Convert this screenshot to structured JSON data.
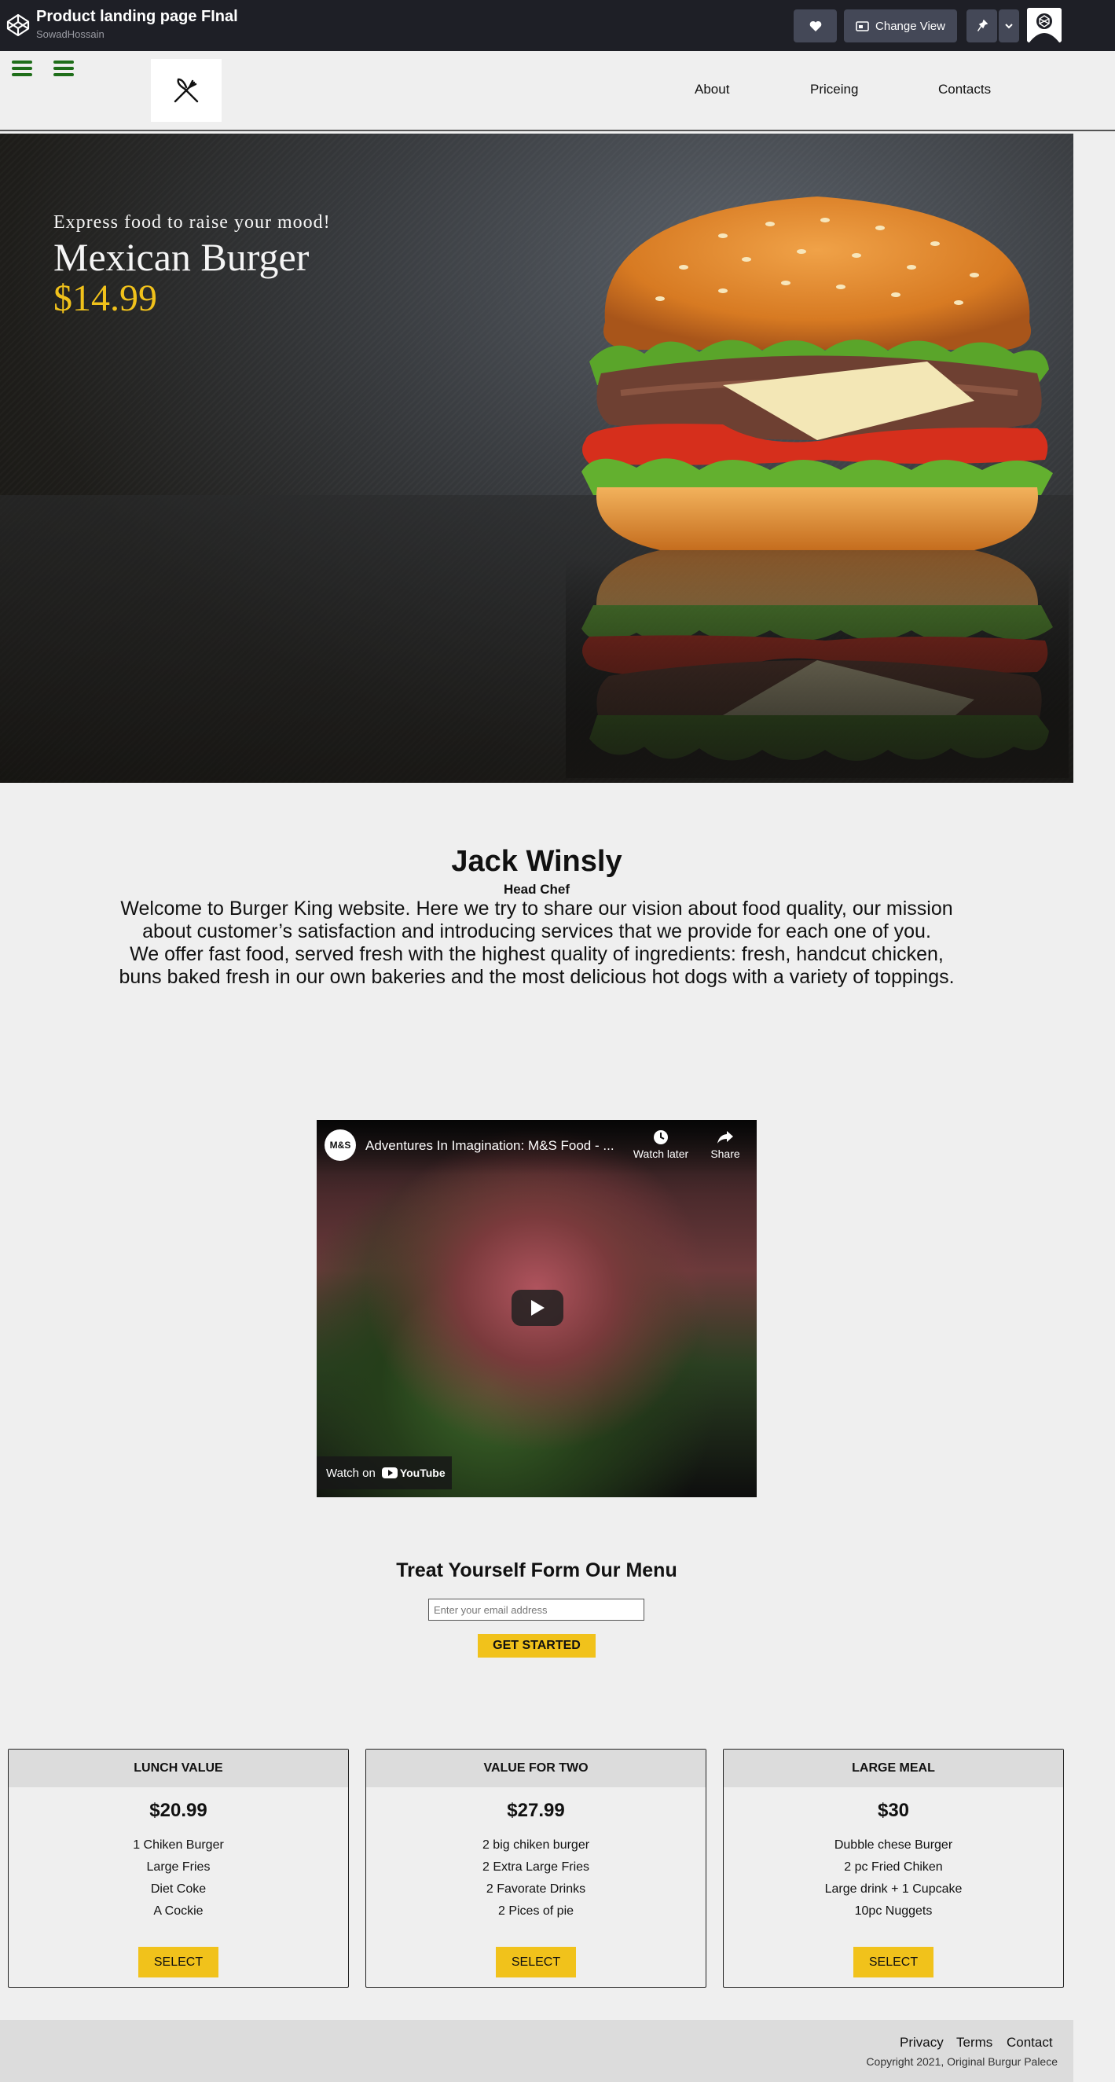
{
  "topbar": {
    "title": "Product landing page FInal",
    "user": "SowadHossain",
    "change_view_label": "Change View"
  },
  "nav": {
    "links": [
      "About",
      "Priceing",
      "Contacts"
    ]
  },
  "hero": {
    "tagline": "Express food to raise your mood!",
    "product": "Mexican Burger",
    "price": "$14.99"
  },
  "about": {
    "name": "Jack Winsly",
    "role": "Head Chef",
    "paragraph1": "Welcome to Burger King website. Here we try to share our vision about food quality, our mission about customer’s satisfaction and introducing services that we provide for each one of you.",
    "paragraph2": "We offer fast food, served fresh with the highest quality of ingredients: fresh, handcut chicken, buns baked fresh in our own bakeries and the most delicious hot dogs with a variety of toppings."
  },
  "video": {
    "channel_logo": "M&S",
    "title": "Adventures In Imagination: M&S Food - ...",
    "watch_later": "Watch later",
    "share": "Share",
    "watch_on": "Watch on",
    "platform": "YouTube"
  },
  "form": {
    "title": "Treat Yourself Form Our Menu",
    "email_placeholder": "Enter your email address",
    "button": "GET STARTED"
  },
  "plans": [
    {
      "name": "LUNCH VALUE",
      "price": "$20.99",
      "items": [
        "1 Chiken Burger",
        "Large Fries",
        "Diet Coke",
        "A Cockie"
      ],
      "button": "SELECT"
    },
    {
      "name": "VALUE FOR TWO",
      "price": "$27.99",
      "items": [
        "2 big chiken burger",
        "2 Extra Large Fries",
        "2 Favorate Drinks",
        "2 Pices of pie"
      ],
      "button": "SELECT"
    },
    {
      "name": "LARGE MEAL",
      "price": "$30",
      "items": [
        "Dubble chese Burger",
        "2 pc Fried Chiken",
        "Large drink + 1 Cupcake",
        "10pc Nuggets"
      ],
      "button": "SELECT"
    }
  ],
  "footer": {
    "links": [
      "Privacy",
      "Terms",
      "Contact"
    ],
    "copyright": "Copyright 2021, Original Burgur Palece"
  },
  "colors": {
    "accent": "#f1c21b",
    "topbar": "#1e1f26",
    "hamburger": "#1f6e1a"
  }
}
